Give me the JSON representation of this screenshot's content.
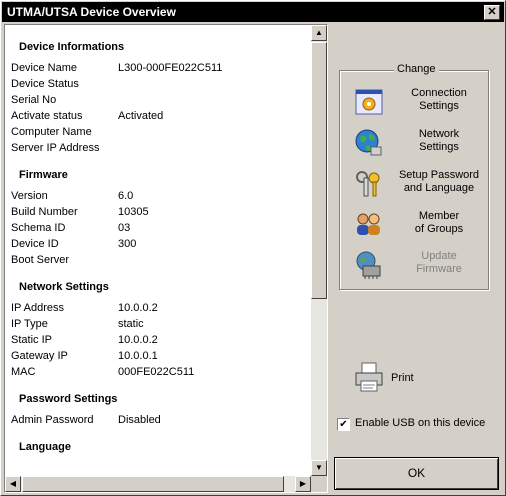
{
  "window": {
    "title": "UTMA/UTSA Device Overview",
    "close_glyph": "✕"
  },
  "info": {
    "sections": [
      {
        "title": "Device Informations",
        "rows": [
          {
            "k": "Device Name",
            "v": "L300-000FE022C511"
          },
          {
            "k": "Device Status",
            "v": ""
          },
          {
            "k": "Serial No",
            "v": ""
          },
          {
            "k": "Activate status",
            "v": "Activated"
          },
          {
            "k": "Computer Name",
            "v": ""
          },
          {
            "k": "Server IP Address",
            "v": ""
          }
        ]
      },
      {
        "title": "Firmware",
        "rows": [
          {
            "k": "Version",
            "v": "6.0"
          },
          {
            "k": "Build Number",
            "v": "10305"
          },
          {
            "k": "Schema ID",
            "v": "03"
          },
          {
            "k": "Device ID",
            "v": "300"
          },
          {
            "k": "Boot Server",
            "v": ""
          }
        ]
      },
      {
        "title": "Network Settings",
        "rows": [
          {
            "k": "IP Address",
            "v": "10.0.0.2"
          },
          {
            "k": "IP Type",
            "v": "static"
          },
          {
            "k": "Static IP",
            "v": "10.0.0.2"
          },
          {
            "k": "Gateway IP",
            "v": "10.0.0.1"
          },
          {
            "k": "MAC",
            "v": "000FE022C511"
          }
        ]
      },
      {
        "title": "Password Settings",
        "rows": [
          {
            "k": "Admin Password",
            "v": "Disabled"
          }
        ]
      },
      {
        "title": "Language",
        "rows": []
      }
    ]
  },
  "change": {
    "group_label": "Change",
    "actions": [
      {
        "l1": "Connection",
        "l2": "Settings",
        "icon": "connection-icon"
      },
      {
        "l1": "Network",
        "l2": "Settings",
        "icon": "globe-icon"
      },
      {
        "l1": "Setup Password",
        "l2": "and Language",
        "icon": "keys-icon"
      },
      {
        "l1": "Member",
        "l2": "of Groups",
        "icon": "users-icon"
      },
      {
        "l1": "Update",
        "l2": "Firmware",
        "icon": "firmware-icon",
        "disabled": true
      }
    ]
  },
  "print": {
    "label": "Print",
    "icon": "printer-icon"
  },
  "usb": {
    "label": "Enable USB on this device",
    "checked": true,
    "check_glyph": "✔"
  },
  "ok": {
    "label": "OK"
  },
  "scroll": {
    "up": "▲",
    "down": "▼",
    "left": "◀",
    "right": "▶"
  }
}
